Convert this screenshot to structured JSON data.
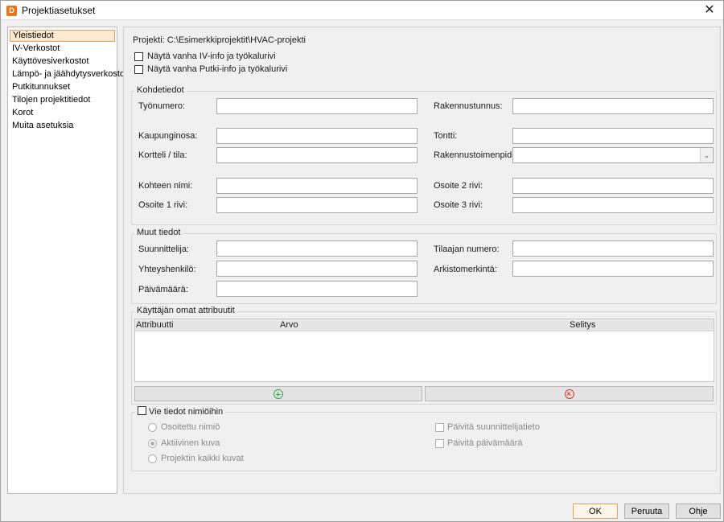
{
  "window": {
    "title": "Projektiasetukset",
    "icon_letter": "D"
  },
  "sidebar": {
    "items": [
      {
        "label": "Yleistiedot",
        "active": true
      },
      {
        "label": "IV-Verkostot"
      },
      {
        "label": "Käyttövesiverkostot"
      },
      {
        "label": "Lämpö- ja jäähdytysverkostot"
      },
      {
        "label": "Putkitunnukset"
      },
      {
        "label": "Tilojen projektitiedot"
      },
      {
        "label": "Korot"
      },
      {
        "label": "Muita asetuksia"
      }
    ]
  },
  "general": {
    "project_path": "Projekti: C:\\Esimerkkiprojektit\\HVAC-projekti",
    "show_old_iv": "Näytä vanha IV-info ja työkalurivi",
    "show_old_putki": "Näytä vanha Putki-info ja työkalurivi"
  },
  "kohdetiedot": {
    "title": "Kohdetiedot",
    "tyonumero": {
      "label": "Työnumero:",
      "value": ""
    },
    "rakennustunnus": {
      "label": "Rakennustunnus:",
      "value": ""
    },
    "kaupunginosa": {
      "label": "Kaupunginosa:",
      "value": ""
    },
    "tontti": {
      "label": "Tontti:",
      "value": ""
    },
    "kortteli": {
      "label": "Kortteli / tila:",
      "value": ""
    },
    "rakennustoimenpide": {
      "label": "Rakennustoimenpide:",
      "value": ""
    },
    "kohteen_nimi": {
      "label": "Kohteen nimi:",
      "value": ""
    },
    "osoite2": {
      "label": "Osoite 2 rivi:",
      "value": ""
    },
    "osoite1": {
      "label": "Osoite 1 rivi:",
      "value": ""
    },
    "osoite3": {
      "label": "Osoite 3 rivi:",
      "value": ""
    }
  },
  "muut": {
    "title": "Muut tiedot",
    "suunnittelija": {
      "label": "Suunnittelija:",
      "value": ""
    },
    "tilaajan_numero": {
      "label": "Tilaajan numero:",
      "value": ""
    },
    "yhteyshenkilo": {
      "label": "Yhteyshenkilö:",
      "value": ""
    },
    "arkistomerkinta": {
      "label": "Arkistomerkintä:",
      "value": ""
    },
    "paivamaara": {
      "label": "Päivämäärä:",
      "value": ""
    }
  },
  "attributes": {
    "title": "Käyttäjän omat attribuutit",
    "columns": [
      "Attribuutti",
      "Arvo",
      "Selitys"
    ],
    "add_icon": "plus-circle-icon",
    "remove_icon": "x-circle-icon",
    "colors": {
      "add": "#2aa84a",
      "remove": "#e03030"
    }
  },
  "export": {
    "label": "Vie tiedot nimiöihin",
    "radios": [
      "Osoitettu nimiö",
      "Aktiivinen kuva",
      "Projektin kaikki kuvat"
    ],
    "selected_radio": "Aktiivinen kuva",
    "checks": [
      "Päivitä suunnittelijatieto",
      "Päivitä päivämäärä"
    ]
  },
  "footer": {
    "ok": "OK",
    "cancel": "Peruuta",
    "help": "Ohje"
  }
}
